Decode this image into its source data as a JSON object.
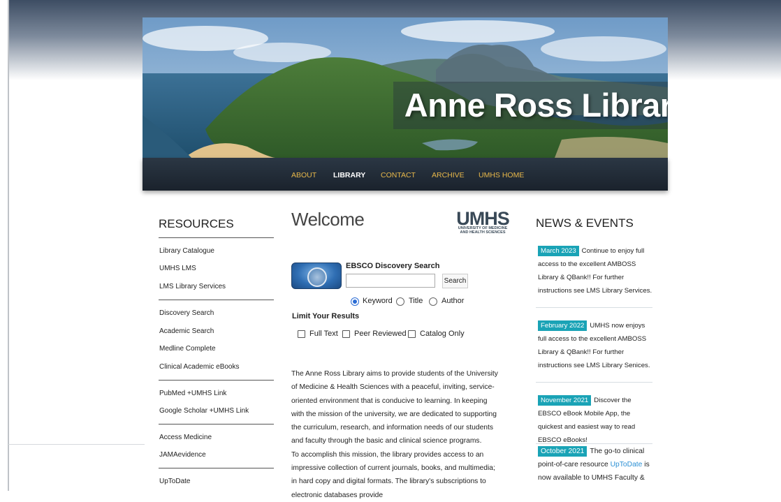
{
  "banner": {
    "title": "Anne Ross Library"
  },
  "nav": {
    "items": [
      {
        "label": "ABOUT",
        "active": false
      },
      {
        "label": "LIBRARY",
        "active": true
      },
      {
        "label": "CONTACT",
        "active": false
      },
      {
        "label": "ARCHIVE",
        "active": false
      },
      {
        "label": "UMHS HOME",
        "active": false
      }
    ]
  },
  "resources": {
    "heading": "RESOURCES",
    "groups": [
      [
        "Library Catalogue",
        "UMHS LMS",
        "LMS Library Services"
      ],
      [
        "Discovery Search",
        "Academic Search",
        "Medline Complete",
        "Clinical Academic eBooks"
      ],
      [
        "PubMed +UMHS Link",
        "Google Scholar +UMHS Link"
      ],
      [
        "Access Medicine",
        "JAMAevidence"
      ],
      [
        "UpToDate"
      ]
    ]
  },
  "main": {
    "heading": "Welcome",
    "logo": {
      "big": "UMHS",
      "small_line1": "UNIVERSITY OF MEDICINE",
      "small_line2": "AND HEALTH SCIENCES"
    },
    "search": {
      "label": "EBSCO Discovery Search",
      "input_value": "",
      "button": "Search",
      "options": [
        "Keyword",
        "Title",
        "Author"
      ],
      "selected": "Keyword",
      "limit_heading": "Limit Your Results",
      "limits": [
        "Full Text",
        "Peer Reviewed",
        "Catalog Only"
      ]
    },
    "paragraph1": "The Anne Ross Library aims to provide students of the University of Medicine & Health Sciences with a peaceful, inviting, service-oriented environment that is conducive to learning. In keeping with the mission of the university, we are dedicated to supporting the curriculum, research, and information needs of our students and faculty through the basic and clinical science programs.",
    "paragraph2": "To accomplish this mission, the library provides access to an impressive collection of current journals, books, and multimedia; in hard copy and digital formats. The library's subscriptions to electronic databases provide"
  },
  "news": {
    "heading": "NEWS & EVENTS",
    "items": [
      {
        "date": "March 2023",
        "text": "Continue to enjoy full access to the excellent AMBOSS Library & QBank!! For further instructions see LMS Library Services."
      },
      {
        "date": "February 2022",
        "text": "UMHS now enjoys full access to the excellent AMBOSS Library & QBank!! For further instructions see LMS Library Senices."
      },
      {
        "date": "November 2021",
        "text": "Discover the EBSCO eBook Mobile App, the quickest and easiest way to read EBSCO eBooks!"
      },
      {
        "date": "October 2021",
        "text_before": "The go-to clinical point-of-care resource",
        "link": "UpToDate",
        "text_after": "is now available to UMHS Faculty &"
      }
    ]
  },
  "colors": {
    "nav_link": "#e8b84a",
    "news_date_bg": "#1aa3b6",
    "link": "#2a8fd4"
  }
}
